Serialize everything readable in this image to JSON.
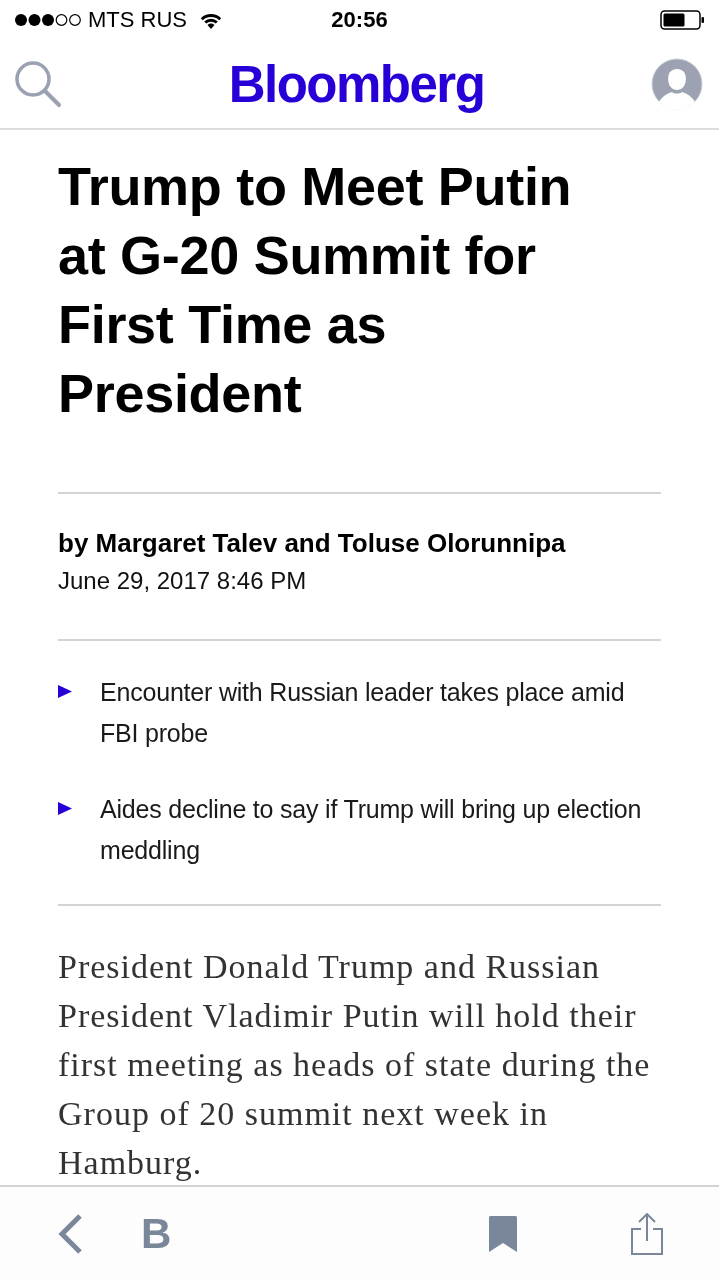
{
  "status_bar": {
    "carrier": "MTS RUS",
    "time": "20:56"
  },
  "nav_bar": {
    "logo": "Bloomberg"
  },
  "article": {
    "headline": "Trump to Meet Putin at G-20 Summit for First Time as President",
    "byline": "by Margaret Talev and Toluse Olorunnipa",
    "date": "June 29, 2017 8:46 PM",
    "bullets": [
      "Encounter with Russian leader takes place amid FBI probe",
      "Aides decline to say if Trump will bring up election meddling"
    ],
    "body": "President Donald Trump and Russian President Vladimir Putin will hold their first meeting as heads of state during the Group of 20 summit next week in Hamburg."
  },
  "toolbar": {
    "logo_letter": "B"
  }
}
